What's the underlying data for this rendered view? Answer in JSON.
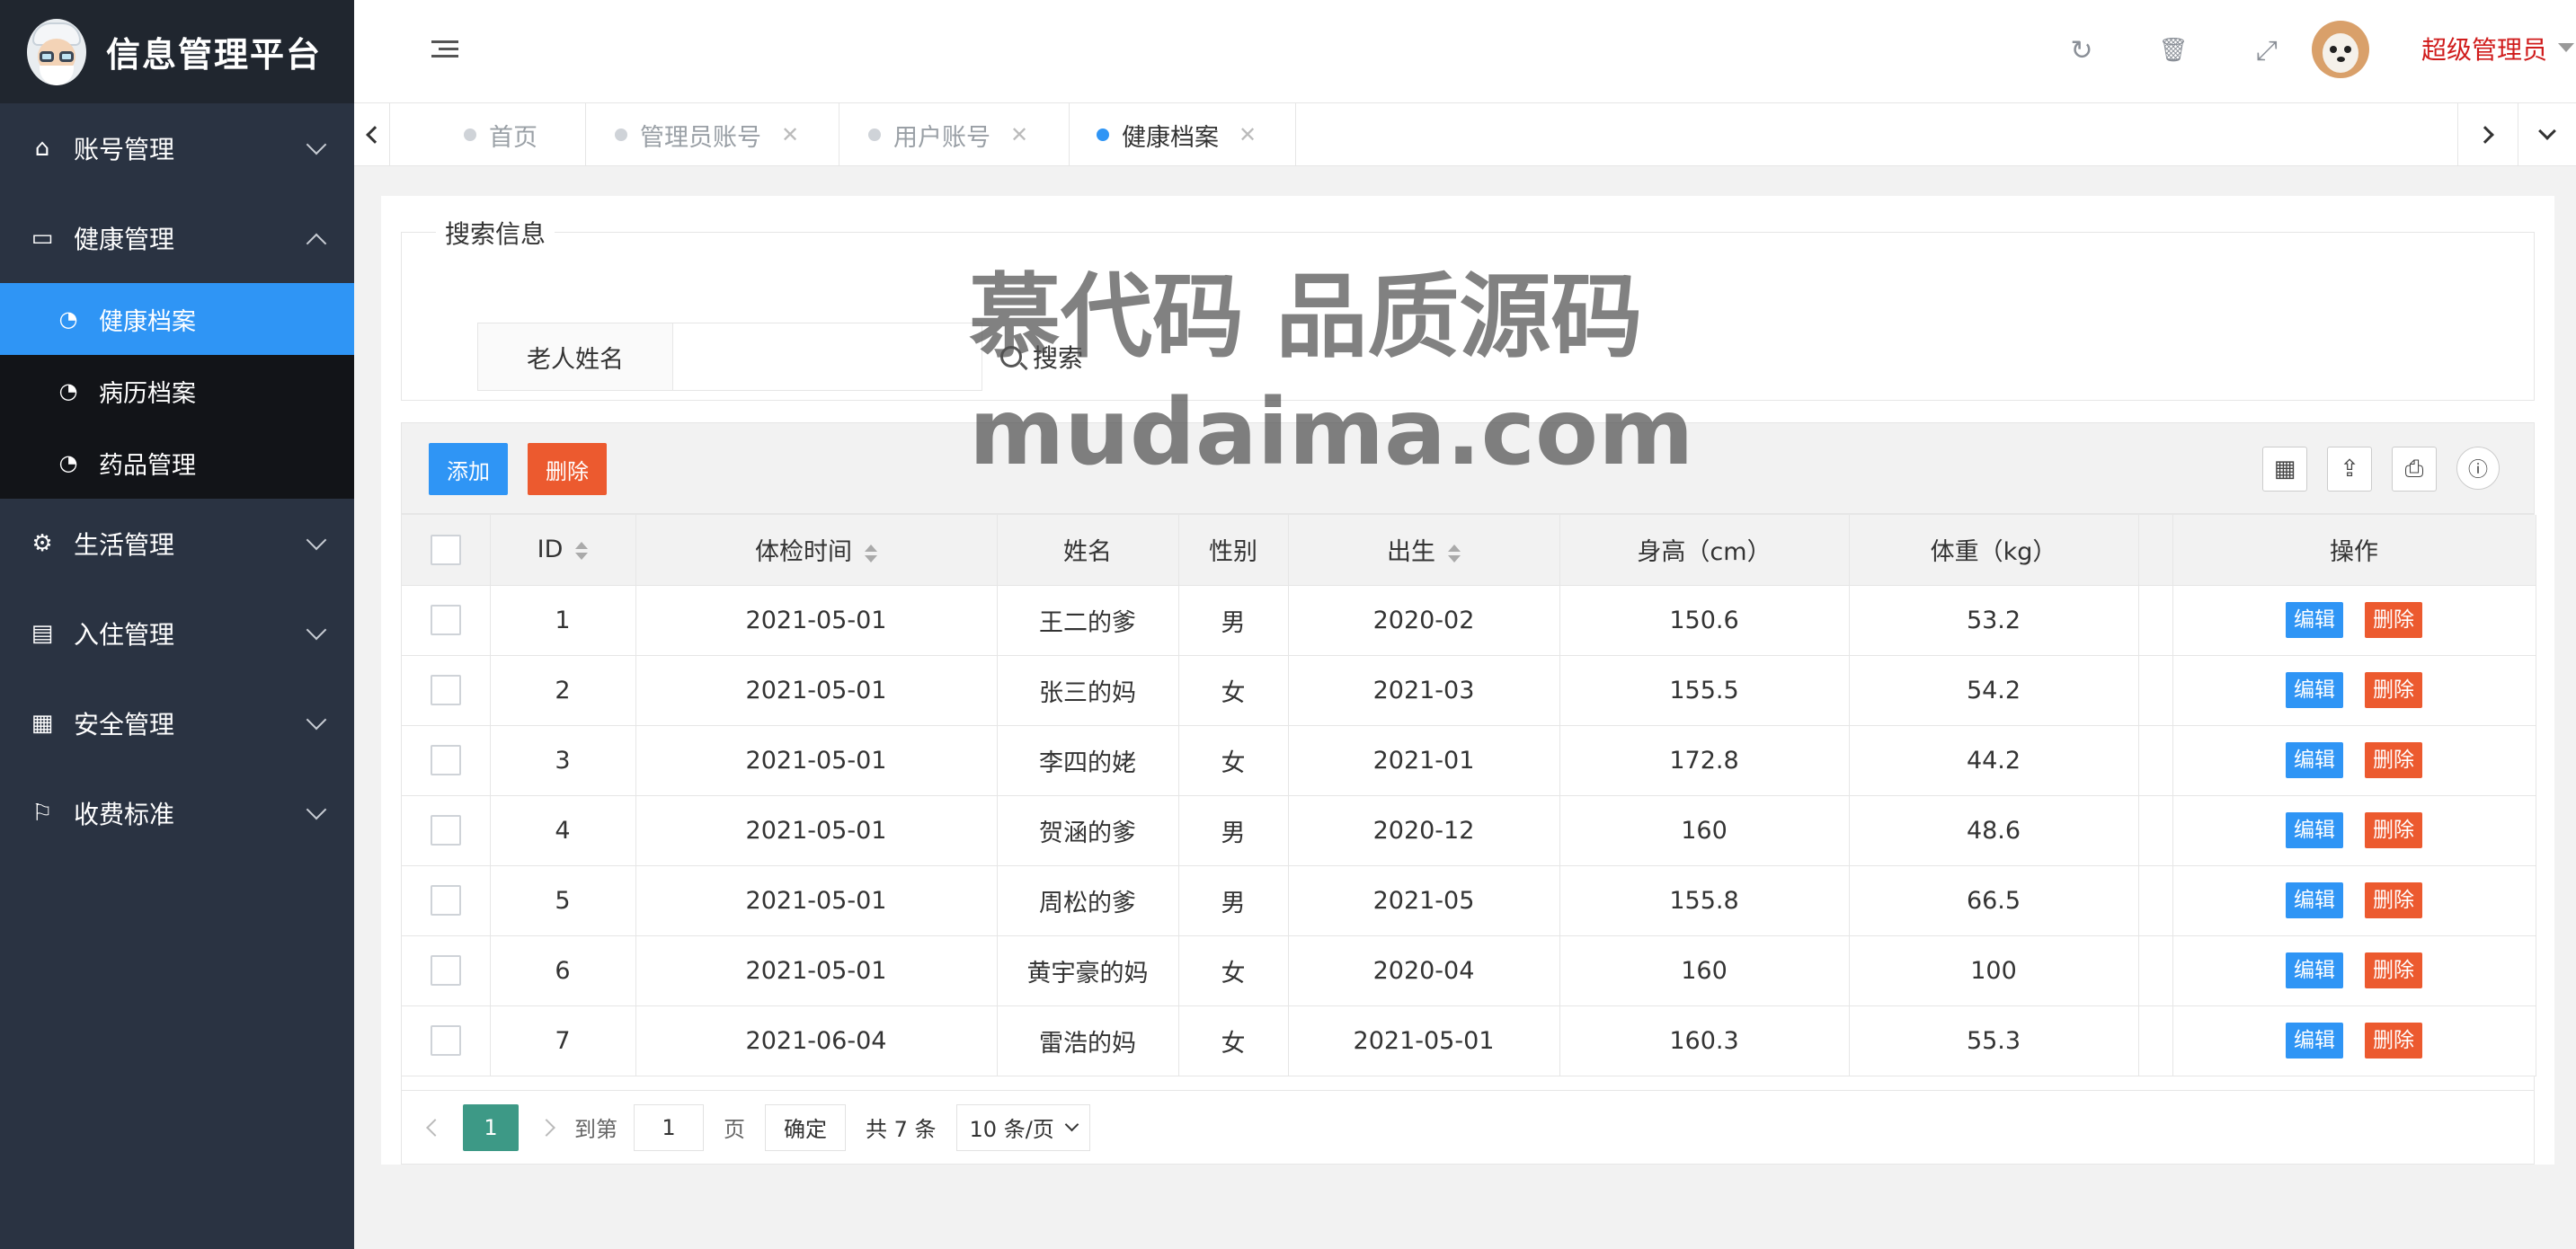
{
  "app": {
    "title": "信息管理平台"
  },
  "sidebar": {
    "items": [
      {
        "label": "账号管理",
        "icon": "home-icon"
      },
      {
        "label": "健康管理",
        "icon": "window-icon",
        "expanded": true,
        "children": [
          {
            "label": "健康档案",
            "icon": "dashboard-icon",
            "active": true
          },
          {
            "label": "病历档案",
            "icon": "dashboard-icon"
          },
          {
            "label": "药品管理",
            "icon": "dashboard-icon"
          }
        ]
      },
      {
        "label": "生活管理",
        "icon": "gears-icon"
      },
      {
        "label": "入住管理",
        "icon": "document-icon"
      },
      {
        "label": "安全管理",
        "icon": "calendar-icon"
      },
      {
        "label": "收费标准",
        "icon": "flag-icon"
      }
    ]
  },
  "header": {
    "icons": [
      "menu-toggle-icon",
      "refresh-icon",
      "trash-icon",
      "fullscreen-icon"
    ],
    "user_name": "超级管理员"
  },
  "tabs": [
    {
      "label": "首页",
      "closable": false
    },
    {
      "label": "管理员账号",
      "closable": true
    },
    {
      "label": "用户账号",
      "closable": true
    },
    {
      "label": "健康档案",
      "closable": true,
      "active": true
    }
  ],
  "search": {
    "legend": "搜索信息",
    "field_label": "老人姓名",
    "value": "",
    "button_label": "搜索"
  },
  "toolbar": {
    "add_label": "添加",
    "delete_label": "删除",
    "right_icons": [
      "columns-icon",
      "export-icon",
      "print-icon",
      "info-icon"
    ]
  },
  "table": {
    "columns": [
      "ID",
      "体检时间",
      "姓名",
      "性别",
      "出生",
      "身高（cm）",
      "体重（kg）",
      "操作"
    ],
    "rows": [
      {
        "id": "1",
        "date": "2021-05-01",
        "name": "王二的爹",
        "gender": "男",
        "birth": "2020-02",
        "height": "150.6",
        "weight": "53.2"
      },
      {
        "id": "2",
        "date": "2021-05-01",
        "name": "张三的妈",
        "gender": "女",
        "birth": "2021-03",
        "height": "155.5",
        "weight": "54.2"
      },
      {
        "id": "3",
        "date": "2021-05-01",
        "name": "李四的姥",
        "gender": "女",
        "birth": "2021-01",
        "height": "172.8",
        "weight": "44.2"
      },
      {
        "id": "4",
        "date": "2021-05-01",
        "name": "贺涵的爹",
        "gender": "男",
        "birth": "2020-12",
        "height": "160",
        "weight": "48.6"
      },
      {
        "id": "5",
        "date": "2021-05-01",
        "name": "周松的爹",
        "gender": "男",
        "birth": "2021-05",
        "height": "155.8",
        "weight": "66.5"
      },
      {
        "id": "6",
        "date": "2021-05-01",
        "name": "黄宇豪的妈",
        "gender": "女",
        "birth": "2020-04",
        "height": "160",
        "weight": "100"
      },
      {
        "id": "7",
        "date": "2021-06-04",
        "name": "雷浩的妈",
        "gender": "女",
        "birth": "2021-05-01",
        "height": "160.3",
        "weight": "55.3"
      }
    ],
    "edit_label": "编辑",
    "delete_label": "删除"
  },
  "pager": {
    "current": "1",
    "goto_prefix": "到第",
    "goto_value": "1",
    "goto_suffix": "页",
    "confirm_label": "确定",
    "total_text": "共 7 条",
    "page_size": "10 条/页"
  },
  "watermark": {
    "line1": "慕代码 品质源码",
    "line2": "mudaima.com"
  }
}
